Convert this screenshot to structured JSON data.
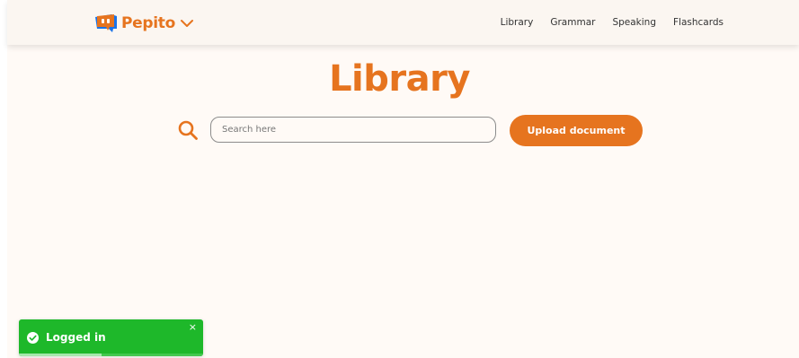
{
  "header": {
    "brand_name": "Pepito",
    "nav": [
      "Library",
      "Grammar",
      "Speaking",
      "Flashcards"
    ]
  },
  "main": {
    "title": "Library",
    "search": {
      "placeholder": "Search here",
      "value": ""
    },
    "upload_label": "Upload document"
  },
  "toast": {
    "message": "Logged in",
    "close_symbol": "×",
    "progress": 0.45
  },
  "colors": {
    "accent": "#e6741f",
    "background": "#fffaf6",
    "toast": "#1eb82a"
  },
  "icons": [
    "pepito-logo-icon",
    "chevron-down-icon",
    "search-icon",
    "check-circle-icon",
    "close-icon"
  ]
}
